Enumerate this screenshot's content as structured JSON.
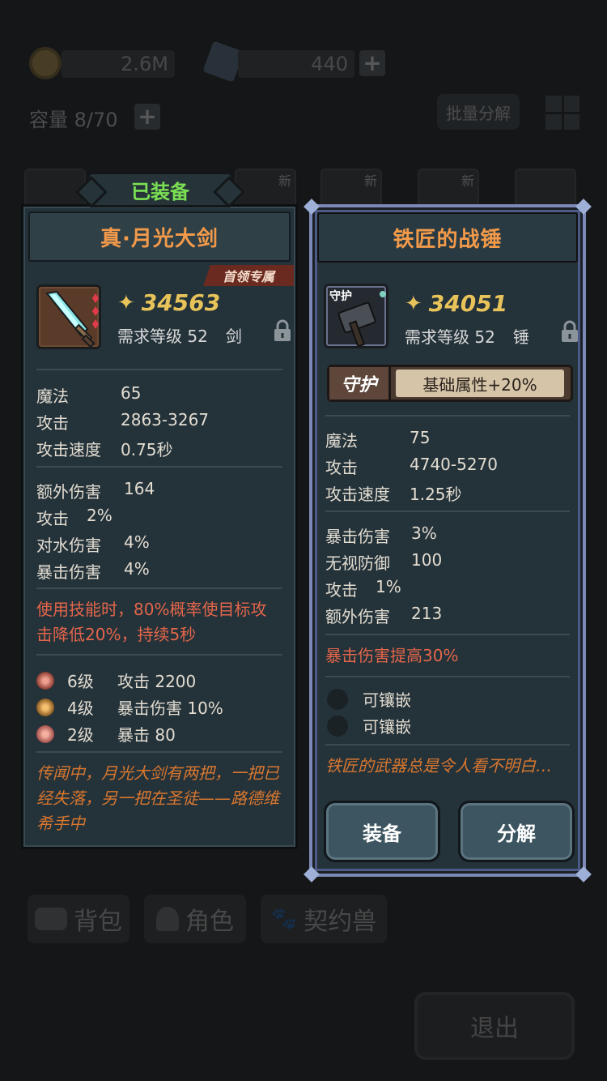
{
  "background": {
    "gold": "2.6M",
    "crystals": "440",
    "capacity": "容量 8/70",
    "batch_decompose": "批量分解",
    "slot_new": "新",
    "tabs": [
      "背包",
      "角色",
      "契约兽"
    ],
    "exit": "退出"
  },
  "left": {
    "equipped_tag": "已装备",
    "title": "真·月光大剑",
    "badge": "首领专属",
    "power": "34563",
    "req_label": "需求等级 52",
    "type": "剑",
    "base_stats": [
      {
        "k": "魔法",
        "v": "65"
      },
      {
        "k": "攻击",
        "v": "2863-3267"
      },
      {
        "k": "攻击速度",
        "v": "0.75秒"
      }
    ],
    "extra_stats": [
      {
        "k": "额外伤害",
        "v": "164"
      },
      {
        "k": "攻击",
        "v": "2%"
      },
      {
        "k": "对水伤害",
        "v": "4%"
      },
      {
        "k": "暴击伤害",
        "v": "4%"
      }
    ],
    "skill_effect": "使用技能时，80%概率使目标攻击降低20%，持续5秒",
    "gems": [
      {
        "lvl": "6级",
        "stat": "攻击 2200"
      },
      {
        "lvl": "4级",
        "stat": "暴击伤害 10%"
      },
      {
        "lvl": "2级",
        "stat": "暴击 80"
      }
    ],
    "lore": "传闻中，月光大剑有两把，一把已经失落，另一把在圣徒——路德维希手中"
  },
  "right": {
    "title": "铁匠的战锤",
    "icon_tag": "守护",
    "power": "34051",
    "req_label": "需求等级 52",
    "type": "锤",
    "guard_label": "守护",
    "guard_value": "基础属性+20%",
    "base_stats": [
      {
        "k": "魔法",
        "v": "75"
      },
      {
        "k": "攻击",
        "v": "4740-5270"
      },
      {
        "k": "攻击速度",
        "v": "1.25秒"
      }
    ],
    "extra_stats": [
      {
        "k": "暴击伤害",
        "v": "3%"
      },
      {
        "k": "无视防御",
        "v": "100"
      },
      {
        "k": "攻击",
        "v": "1%"
      },
      {
        "k": "额外伤害",
        "v": "213"
      }
    ],
    "special": "暴击伤害提高30%",
    "sockets": [
      "可镶嵌",
      "可镶嵌"
    ],
    "lore": "铁匠的武器总是令人看不明白…",
    "equip_button": "装备",
    "decompose_button": "分解"
  },
  "colors": {
    "title_orange": "#f29a4a",
    "equipped_green": "#7be053",
    "power_gold": "#e8c35a",
    "effect_red": "#e3664a",
    "lore_orange": "#d9772f",
    "panel_bg": "#24323a",
    "rare_border": "#7b88b8"
  }
}
